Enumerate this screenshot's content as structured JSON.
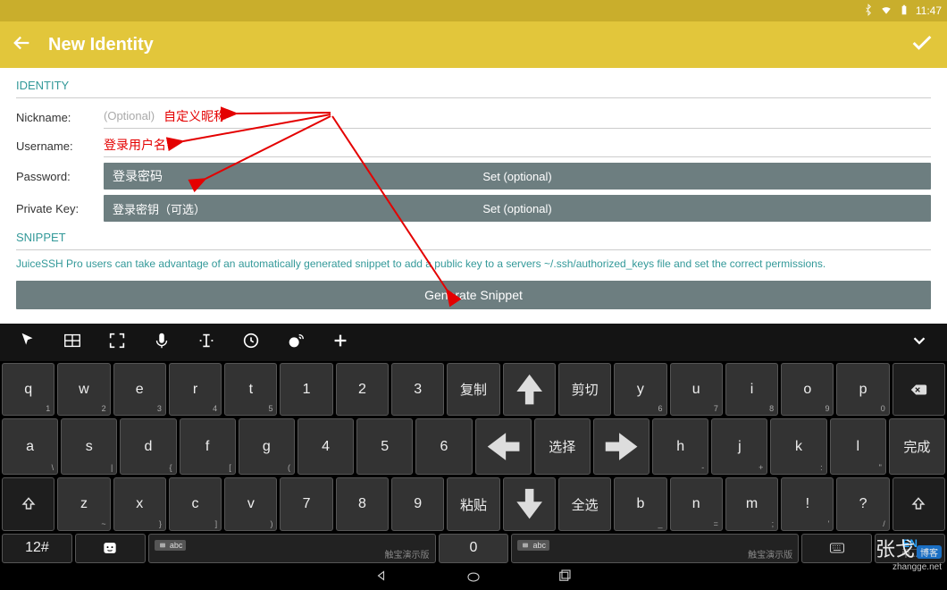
{
  "status": {
    "time": "11:47"
  },
  "appbar": {
    "title": "New Identity"
  },
  "sections": {
    "identity": "IDENTITY",
    "snippet": "SNIPPET"
  },
  "fields": {
    "nickname": {
      "label": "Nickname:",
      "placeholder": "(Optional)",
      "note": "自定义昵称"
    },
    "username": {
      "label": "Username:",
      "note": "登录用户名"
    },
    "password": {
      "label": "Password:",
      "note": "登录密码",
      "button": "Set (optional)"
    },
    "privatekey": {
      "label": "Private Key:",
      "note": "登录密钥（可选）",
      "button": "Set (optional)"
    }
  },
  "snippet": {
    "desc": "JuiceSSH Pro users can take advantage of an automatically generated snippet to add a public key to a servers ~/.ssh/authorized_keys file and set the correct permissions.",
    "button": "Generate Snippet"
  },
  "kb": {
    "r1": [
      "q",
      "w",
      "e",
      "r",
      "t",
      "1",
      "2",
      "3",
      "复制",
      "↑",
      "剪切",
      "y",
      "u",
      "i",
      "o",
      "p",
      "⌫"
    ],
    "r1sub": [
      "1",
      "2",
      "3",
      "4",
      "5",
      "",
      "",
      "",
      "",
      "",
      "",
      "6",
      "7",
      "8",
      "9",
      "0",
      ""
    ],
    "r2": [
      "a",
      "s",
      "d",
      "f",
      "g",
      "4",
      "5",
      "6",
      "←",
      "选择",
      "→",
      "h",
      "j",
      "k",
      "l",
      "完成"
    ],
    "r2sub": [
      "\\",
      "|",
      "{",
      "[",
      "(",
      "",
      "",
      "",
      "",
      "",
      "",
      "-",
      "+",
      ":",
      "\"",
      ""
    ],
    "r3": [
      "⇧",
      "z",
      "x",
      "c",
      "v",
      "7",
      "8",
      "9",
      "粘贴",
      "↓",
      "全选",
      "b",
      "n",
      "m",
      "!",
      "?",
      "⇧"
    ],
    "r3sub": [
      "",
      "~",
      "}",
      "]",
      ")",
      "",
      "",
      "",
      "",
      "",
      "",
      "_",
      "=",
      ";",
      "'",
      "/",
      ""
    ],
    "r4": {
      "left_mode": "12#",
      "space_hint": "abc",
      "space_brand": "触宝演示版",
      "zero": "0",
      "en": "EN",
      "cn": "中…"
    }
  },
  "watermark": {
    "line1": "张戈",
    "line2": "zhangge.net",
    "pill": "博客"
  }
}
